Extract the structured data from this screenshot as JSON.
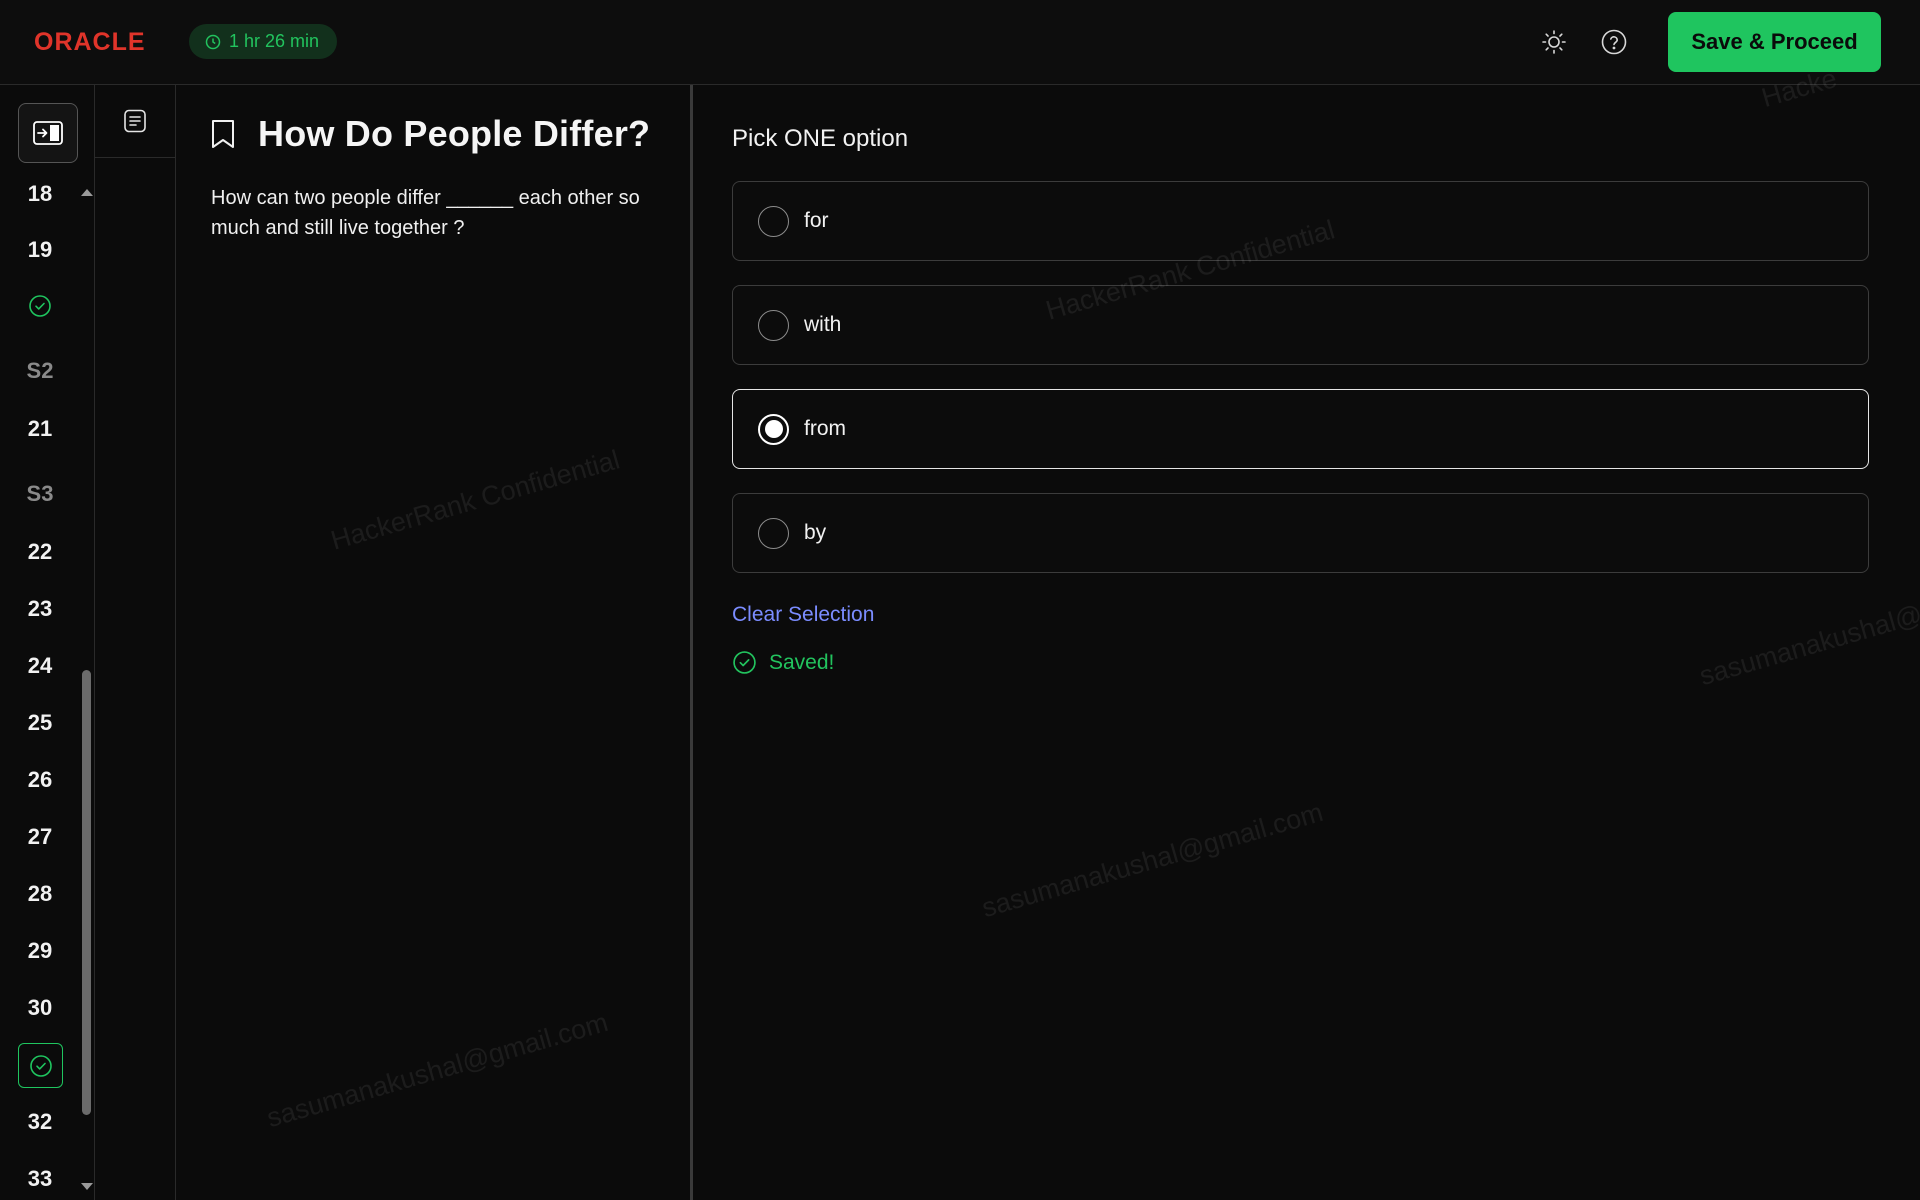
{
  "header": {
    "logo_text": "ORACLE",
    "timer_text": "1 hr 26 min",
    "theme_icon": "sun-icon",
    "help_icon": "help-circle-icon",
    "save_label": "Save & Proceed"
  },
  "rail": {
    "collapse_icon": "panel-collapse-icon",
    "items": {
      "q18": "18",
      "q19": "19",
      "s2": "S2",
      "q21": "21",
      "s3": "S3",
      "q22": "22",
      "q23": "23",
      "q24": "24",
      "q25": "25",
      "q26": "26",
      "q27": "27",
      "q28": "28",
      "q29": "29",
      "q30": "30",
      "q32": "32",
      "q33": "33"
    }
  },
  "tools": {
    "notes_icon": "document-icon"
  },
  "question": {
    "title": "How Do People Differ?",
    "body": "How can two people differ ______ each other so much and still live together ?"
  },
  "answer": {
    "prompt": "Pick ONE option",
    "options": [
      "for",
      "with",
      "from",
      "by"
    ],
    "selected_index": 2,
    "clear_label": "Clear Selection",
    "saved_label": "Saved!"
  },
  "watermarks": {
    "confidential": "HackerRank Confidential",
    "email": "sasumanakushal@gmail.com",
    "partial_top": "Hacke",
    "partial_right": "sasumanakushal@"
  },
  "colors": {
    "accent_green": "#1fc55f",
    "brand_red": "#e0342a",
    "link_blue": "#7b8cff",
    "background": "#0b0b0b"
  }
}
